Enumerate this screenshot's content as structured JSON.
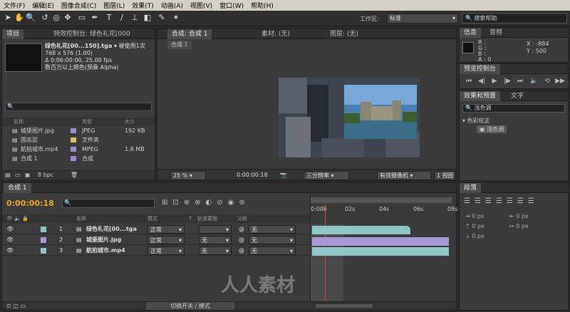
{
  "menu": [
    "文件(F)",
    "编辑(E)",
    "图像合成(C)",
    "图层(L)",
    "效果(T)",
    "动画(A)",
    "视图(V)",
    "窗口(W)",
    "帮助(H)"
  ],
  "toolbar": {
    "workspace_label": "工作区:",
    "workspace_value": "标准",
    "search_placeholder": "搜索帮助"
  },
  "project": {
    "tabs": [
      "项目",
      "特效控制台: 绿色礼花[000"
    ],
    "footage_name": "绿色礼花[00...150].tga ▾",
    "used_times": "被使用1次",
    "line1": "768 x 576 (1.00)",
    "line2": "Δ 0:06:00:00, 25.00 fps",
    "line3": "数百万以上颜色(预乘 Alpha)",
    "cols": [
      "名称",
      "类型",
      "大小"
    ],
    "items": [
      {
        "name": "城堡图片.jpg",
        "type": "JPEG",
        "size": "192 KB",
        "color": "#9b8ccf"
      },
      {
        "name": "固态层",
        "type": "文件夹",
        "size": "",
        "color": "#d6c36a"
      },
      {
        "name": "航拍城市.mp4",
        "type": "MPEG",
        "size": "1.8 MB",
        "color": "#9b8ccf"
      },
      {
        "name": "合成 1",
        "type": "合成",
        "size": "",
        "color": "#9b8ccf"
      }
    ],
    "bpc": "8 bpc"
  },
  "comp": {
    "tabs": [
      "合成: 合成 1",
      "素材: (无)",
      "图层: (无)"
    ],
    "breadcrumb": "合成 1",
    "zoom": "25 %",
    "timecode": "0:00:00:18",
    "res": "三分辨率",
    "camera": "有效摄像机",
    "views": "1 视图",
    "colors": {
      "bg": "#1a1a1a"
    }
  },
  "info": {
    "tabs": [
      "信息",
      "音频"
    ],
    "r": "R :",
    "g": "G :",
    "b": "B :",
    "a": "A : 0",
    "x": "X : -884",
    "y": "Y : 500"
  },
  "preview": {
    "tab": "预览控制台"
  },
  "effects": {
    "tabs": [
      "效果和预置",
      "文字"
    ],
    "search_value": "浅色调",
    "category": "▾ 色彩校正",
    "item": "浅色调"
  },
  "timeline": {
    "tab": "合成 1",
    "timecode": "0:00:00:18",
    "cols": [
      "名称",
      "模式",
      "T",
      "轨道蒙版",
      "父级"
    ],
    "ruler": [
      "0:00s",
      "02s",
      "04s",
      "06s",
      "08s"
    ],
    "layers": [
      {
        "num": "1",
        "name": "绿色礼花[00...tga",
        "mode": "正常",
        "trk": "",
        "parent": "无",
        "color": "#8fc6c6"
      },
      {
        "num": "2",
        "name": "城堡图片.jpg",
        "mode": "正常",
        "trk": "无",
        "parent": "无",
        "color": "#a898d4"
      },
      {
        "num": "3",
        "name": "航拍城市.mp4",
        "mode": "正常",
        "trk": "无",
        "parent": "无",
        "color": "#8fc6c6"
      }
    ],
    "footer": "切换开关 / 模式"
  },
  "paragraph": {
    "tab": "段落",
    "px": [
      "0 px",
      "0 px",
      "0 px",
      "0 px",
      "0 px"
    ]
  },
  "watermark": "人人素材"
}
